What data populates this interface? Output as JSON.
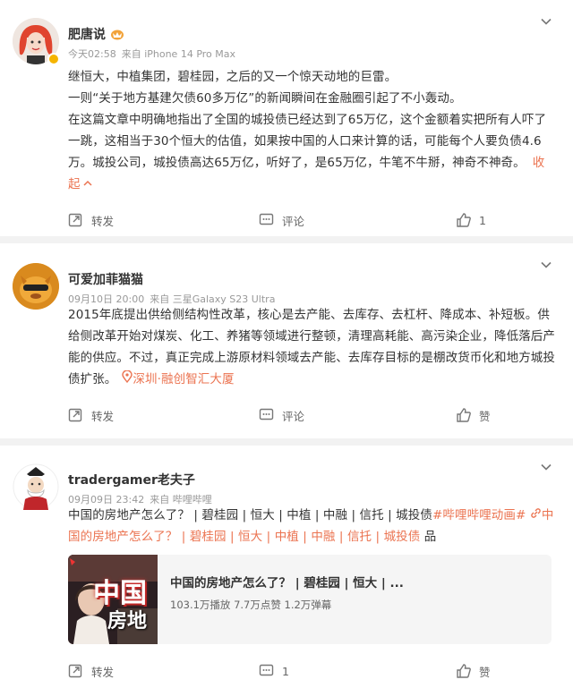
{
  "posts": [
    {
      "author": "肥唐说",
      "time": "今天02:58",
      "source": "来自 iPhone 14 Pro Max",
      "paragraphs": [
        "继恒大，中植集团，碧桂园，之后的又一个惊天动地的巨雷。",
        "一则“关于地方基建欠债60多万亿”的新闻瞬间在金融圈引起了不小轰动。",
        "在这篇文章中明确地指出了全国的城投债已经达到了65万亿，这个金额着实把所有人吓了一跳，这相当于30个恒大的估值，如果按中国的人口来计算的话，可能每个人要负债4.6万。城投公司，城投债高达65万亿，听好了，是65万亿，牛笔不牛掰，神奇不神奇。"
      ],
      "collapse_label": "收起",
      "repost_label": "转发",
      "comment_label": "评论",
      "like_count": "1"
    },
    {
      "author": "可爱加菲猫猫",
      "time": "09月10日 20:00",
      "source": "来自 三星Galaxy S23 Ultra",
      "text": "2015年底提出供给侧结构性改革，核心是去产能、去库存、去杠杆、降成本、补短板。供给侧改革开始对煤炭、化工、养猪等领域进行整顿，清理高耗能、高污染企业，降低落后产能的供应。不过，真正完成上游原材料领域去产能、去库存目标的是棚改货币化和地方城投债扩张。",
      "location": "深圳·融创智汇大厦",
      "repost_label": "转发",
      "comment_label": "评论",
      "like_label": "赞"
    },
    {
      "author": "tradergamer老夫子",
      "time": "09月09日 23:42",
      "source": "来自 哔哩哔哩",
      "text_start": "中国的房地产怎么了？ | 碧桂园 | 恒大 | 中植 | 中融 | 信托 | 城投债",
      "hashtag": "#哔哩哔哩动画#",
      "link": "中国的房地产怎么了？ | 碧桂园 | 恒大 | 中植 | 中融 | 信托 | 城投债",
      "link_suffix": "品",
      "video": {
        "title": "中国的房地产怎么了？ | 碧桂园 | 恒大 | ...",
        "stats": "103.1万播放 7.7万点赞 1.2万弹幕",
        "thumb_text_1": "中国",
        "thumb_text_2": "房地"
      },
      "repost_label": "转发",
      "comment_count": "1",
      "like_label": "赞"
    }
  ],
  "colors": {
    "accent": "#eb7350",
    "gold_badge": "#f5b400",
    "muted": "#999999"
  },
  "icons": [
    "chevron-down-icon",
    "repost-icon",
    "comment-icon",
    "like-icon",
    "location-icon",
    "link-icon",
    "vip-crown-icon"
  ]
}
